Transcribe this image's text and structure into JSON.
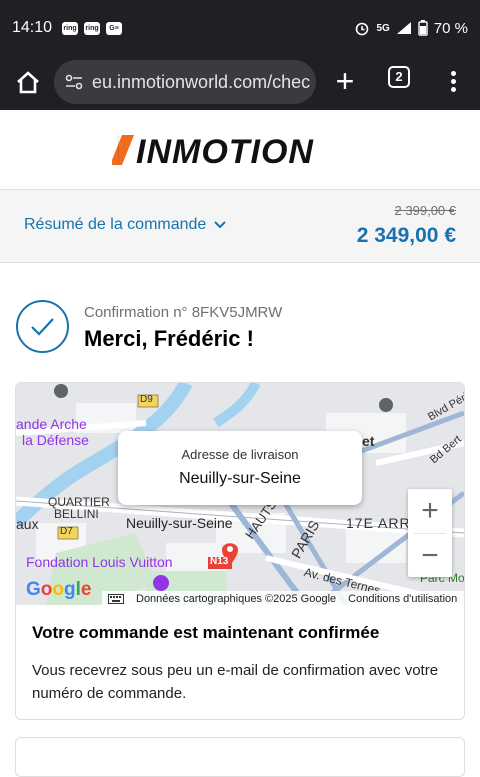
{
  "status_bar": {
    "time": "14:10",
    "notif_icons": [
      "ring",
      "ring",
      "G≡"
    ],
    "network": "5G",
    "battery": "70 %"
  },
  "browser": {
    "url": "eu.inmotionworld.com/chec",
    "tab_count": "2"
  },
  "store": {
    "logo_text": "INMOTION",
    "accent_color": "#f26c1e"
  },
  "order_summary": {
    "toggle_label": "Résumé de la commande",
    "original_price": "2 399,00 €",
    "total_price": "2 349,00 €"
  },
  "confirmation": {
    "number_label": "Confirmation n° 8FKV5JMRW",
    "thanks": "Merci, Frédéric !"
  },
  "map": {
    "popup_label": "Adresse de livraison",
    "popup_value": "Neuilly-sur-Seine",
    "labels": {
      "arche": "ande Arche",
      "defense": "la Défense",
      "quartier": "QUARTIER",
      "bellini": "BELLINI",
      "aux": "aux",
      "neuilly": "Neuilly-sur-Seine",
      "hauts": "HAUTS-DE-S",
      "paris": "PARIS",
      "arr17": "17E ARR",
      "fondation": "Fondation Louis Vuitton",
      "avternes": "Av. des Ternes",
      "parcmo": "Parc Mo",
      "bdperi": "Blvd Péri",
      "bdbert": "Bd Bert",
      "et": "et",
      "d9": "D9",
      "d7": "D7",
      "n13": "N13"
    },
    "google": "Google",
    "attribution": "Données cartographiques ©2025 Google",
    "terms": "Conditions d'utilisation",
    "zoom_in": "+",
    "zoom_out": "−"
  },
  "status_card": {
    "title": "Votre commande est maintenant confirmée",
    "text": "Vous recevrez sous peu un e-mail de confirmation avec votre numéro de commande."
  }
}
